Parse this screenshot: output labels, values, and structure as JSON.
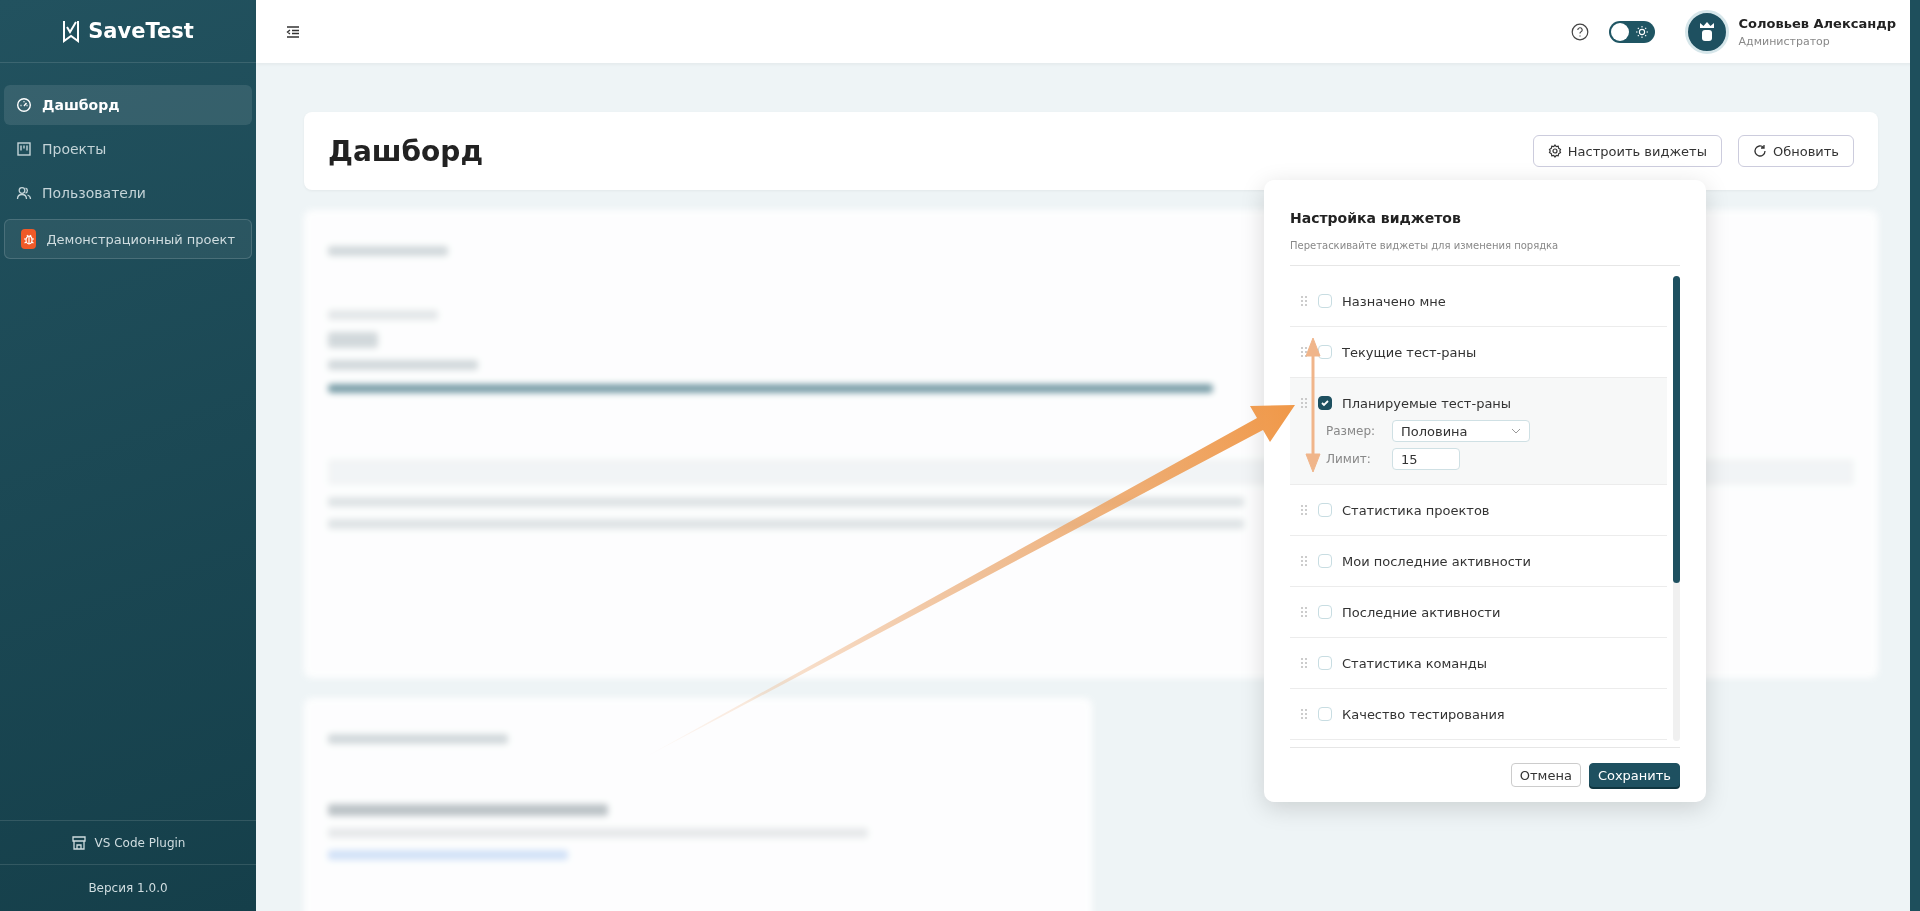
{
  "sidebar": {
    "logo": "SaveTest",
    "items": [
      {
        "label": "Дашборд",
        "kind": "gauge",
        "selected": true
      },
      {
        "label": "Проекты",
        "kind": "board",
        "selected": false
      },
      {
        "label": "Пользователи",
        "kind": "users",
        "selected": false
      }
    ],
    "project": {
      "label": "Демонстрационный проект"
    },
    "plugin": "VS Code Plugin",
    "version": "Версия 1.0.0"
  },
  "header": {
    "theme_toggle": {
      "on": false
    },
    "user": {
      "name": "Соловьев Александр",
      "role": "Администратор"
    }
  },
  "page": {
    "title": "Дашборд",
    "buttons": [
      {
        "label": "Настроить виджеты",
        "kind": "settings"
      },
      {
        "label": "Обновить",
        "kind": "refresh"
      }
    ]
  },
  "widget_popup": {
    "title": "Настройка виджетов",
    "subtitle": "Перетаскивайте виджеты для изменения порядка",
    "widgets": [
      {
        "label": "Назначено мне",
        "checked": false
      },
      {
        "label": "Текущие тест-раны",
        "checked": false
      },
      {
        "label": "Планируемые тест-раны",
        "checked": true,
        "settings": {
          "size_label": "Размер:",
          "size": "Половина",
          "limit_label": "Лимит:",
          "limit": "15"
        }
      },
      {
        "label": "Статистика проектов",
        "checked": false
      },
      {
        "label": "Мои последние активности",
        "checked": false
      },
      {
        "label": "Последние активности",
        "checked": false
      },
      {
        "label": "Статистика команды",
        "checked": false
      },
      {
        "label": "Качество тестирования",
        "checked": false
      }
    ],
    "buttons": [
      {
        "label": "Отмена",
        "kind": "secondary"
      },
      {
        "label": "Сохранить",
        "kind": "primary"
      }
    ]
  }
}
